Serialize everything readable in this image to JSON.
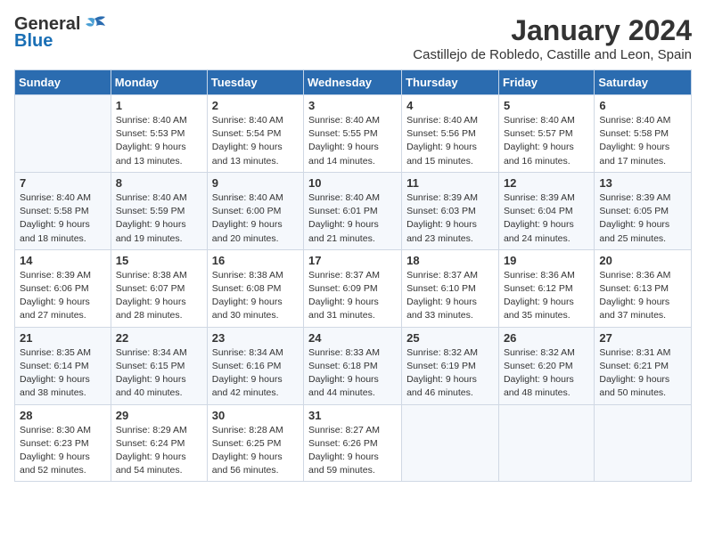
{
  "logo": {
    "general": "General",
    "blue": "Blue"
  },
  "title": "January 2024",
  "location": "Castillejo de Robledo, Castille and Leon, Spain",
  "days_header": [
    "Sunday",
    "Monday",
    "Tuesday",
    "Wednesday",
    "Thursday",
    "Friday",
    "Saturday"
  ],
  "weeks": [
    [
      {
        "day": "",
        "sunrise": "",
        "sunset": "",
        "daylight": ""
      },
      {
        "day": "1",
        "sunrise": "Sunrise: 8:40 AM",
        "sunset": "Sunset: 5:53 PM",
        "daylight": "Daylight: 9 hours and 13 minutes."
      },
      {
        "day": "2",
        "sunrise": "Sunrise: 8:40 AM",
        "sunset": "Sunset: 5:54 PM",
        "daylight": "Daylight: 9 hours and 13 minutes."
      },
      {
        "day": "3",
        "sunrise": "Sunrise: 8:40 AM",
        "sunset": "Sunset: 5:55 PM",
        "daylight": "Daylight: 9 hours and 14 minutes."
      },
      {
        "day": "4",
        "sunrise": "Sunrise: 8:40 AM",
        "sunset": "Sunset: 5:56 PM",
        "daylight": "Daylight: 9 hours and 15 minutes."
      },
      {
        "day": "5",
        "sunrise": "Sunrise: 8:40 AM",
        "sunset": "Sunset: 5:57 PM",
        "daylight": "Daylight: 9 hours and 16 minutes."
      },
      {
        "day": "6",
        "sunrise": "Sunrise: 8:40 AM",
        "sunset": "Sunset: 5:58 PM",
        "daylight": "Daylight: 9 hours and 17 minutes."
      }
    ],
    [
      {
        "day": "7",
        "sunrise": "Sunrise: 8:40 AM",
        "sunset": "Sunset: 5:58 PM",
        "daylight": "Daylight: 9 hours and 18 minutes."
      },
      {
        "day": "8",
        "sunrise": "Sunrise: 8:40 AM",
        "sunset": "Sunset: 5:59 PM",
        "daylight": "Daylight: 9 hours and 19 minutes."
      },
      {
        "day": "9",
        "sunrise": "Sunrise: 8:40 AM",
        "sunset": "Sunset: 6:00 PM",
        "daylight": "Daylight: 9 hours and 20 minutes."
      },
      {
        "day": "10",
        "sunrise": "Sunrise: 8:40 AM",
        "sunset": "Sunset: 6:01 PM",
        "daylight": "Daylight: 9 hours and 21 minutes."
      },
      {
        "day": "11",
        "sunrise": "Sunrise: 8:39 AM",
        "sunset": "Sunset: 6:03 PM",
        "daylight": "Daylight: 9 hours and 23 minutes."
      },
      {
        "day": "12",
        "sunrise": "Sunrise: 8:39 AM",
        "sunset": "Sunset: 6:04 PM",
        "daylight": "Daylight: 9 hours and 24 minutes."
      },
      {
        "day": "13",
        "sunrise": "Sunrise: 8:39 AM",
        "sunset": "Sunset: 6:05 PM",
        "daylight": "Daylight: 9 hours and 25 minutes."
      }
    ],
    [
      {
        "day": "14",
        "sunrise": "Sunrise: 8:39 AM",
        "sunset": "Sunset: 6:06 PM",
        "daylight": "Daylight: 9 hours and 27 minutes."
      },
      {
        "day": "15",
        "sunrise": "Sunrise: 8:38 AM",
        "sunset": "Sunset: 6:07 PM",
        "daylight": "Daylight: 9 hours and 28 minutes."
      },
      {
        "day": "16",
        "sunrise": "Sunrise: 8:38 AM",
        "sunset": "Sunset: 6:08 PM",
        "daylight": "Daylight: 9 hours and 30 minutes."
      },
      {
        "day": "17",
        "sunrise": "Sunrise: 8:37 AM",
        "sunset": "Sunset: 6:09 PM",
        "daylight": "Daylight: 9 hours and 31 minutes."
      },
      {
        "day": "18",
        "sunrise": "Sunrise: 8:37 AM",
        "sunset": "Sunset: 6:10 PM",
        "daylight": "Daylight: 9 hours and 33 minutes."
      },
      {
        "day": "19",
        "sunrise": "Sunrise: 8:36 AM",
        "sunset": "Sunset: 6:12 PM",
        "daylight": "Daylight: 9 hours and 35 minutes."
      },
      {
        "day": "20",
        "sunrise": "Sunrise: 8:36 AM",
        "sunset": "Sunset: 6:13 PM",
        "daylight": "Daylight: 9 hours and 37 minutes."
      }
    ],
    [
      {
        "day": "21",
        "sunrise": "Sunrise: 8:35 AM",
        "sunset": "Sunset: 6:14 PM",
        "daylight": "Daylight: 9 hours and 38 minutes."
      },
      {
        "day": "22",
        "sunrise": "Sunrise: 8:34 AM",
        "sunset": "Sunset: 6:15 PM",
        "daylight": "Daylight: 9 hours and 40 minutes."
      },
      {
        "day": "23",
        "sunrise": "Sunrise: 8:34 AM",
        "sunset": "Sunset: 6:16 PM",
        "daylight": "Daylight: 9 hours and 42 minutes."
      },
      {
        "day": "24",
        "sunrise": "Sunrise: 8:33 AM",
        "sunset": "Sunset: 6:18 PM",
        "daylight": "Daylight: 9 hours and 44 minutes."
      },
      {
        "day": "25",
        "sunrise": "Sunrise: 8:32 AM",
        "sunset": "Sunset: 6:19 PM",
        "daylight": "Daylight: 9 hours and 46 minutes."
      },
      {
        "day": "26",
        "sunrise": "Sunrise: 8:32 AM",
        "sunset": "Sunset: 6:20 PM",
        "daylight": "Daylight: 9 hours and 48 minutes."
      },
      {
        "day": "27",
        "sunrise": "Sunrise: 8:31 AM",
        "sunset": "Sunset: 6:21 PM",
        "daylight": "Daylight: 9 hours and 50 minutes."
      }
    ],
    [
      {
        "day": "28",
        "sunrise": "Sunrise: 8:30 AM",
        "sunset": "Sunset: 6:23 PM",
        "daylight": "Daylight: 9 hours and 52 minutes."
      },
      {
        "day": "29",
        "sunrise": "Sunrise: 8:29 AM",
        "sunset": "Sunset: 6:24 PM",
        "daylight": "Daylight: 9 hours and 54 minutes."
      },
      {
        "day": "30",
        "sunrise": "Sunrise: 8:28 AM",
        "sunset": "Sunset: 6:25 PM",
        "daylight": "Daylight: 9 hours and 56 minutes."
      },
      {
        "day": "31",
        "sunrise": "Sunrise: 8:27 AM",
        "sunset": "Sunset: 6:26 PM",
        "daylight": "Daylight: 9 hours and 59 minutes."
      },
      {
        "day": "",
        "sunrise": "",
        "sunset": "",
        "daylight": ""
      },
      {
        "day": "",
        "sunrise": "",
        "sunset": "",
        "daylight": ""
      },
      {
        "day": "",
        "sunrise": "",
        "sunset": "",
        "daylight": ""
      }
    ]
  ]
}
